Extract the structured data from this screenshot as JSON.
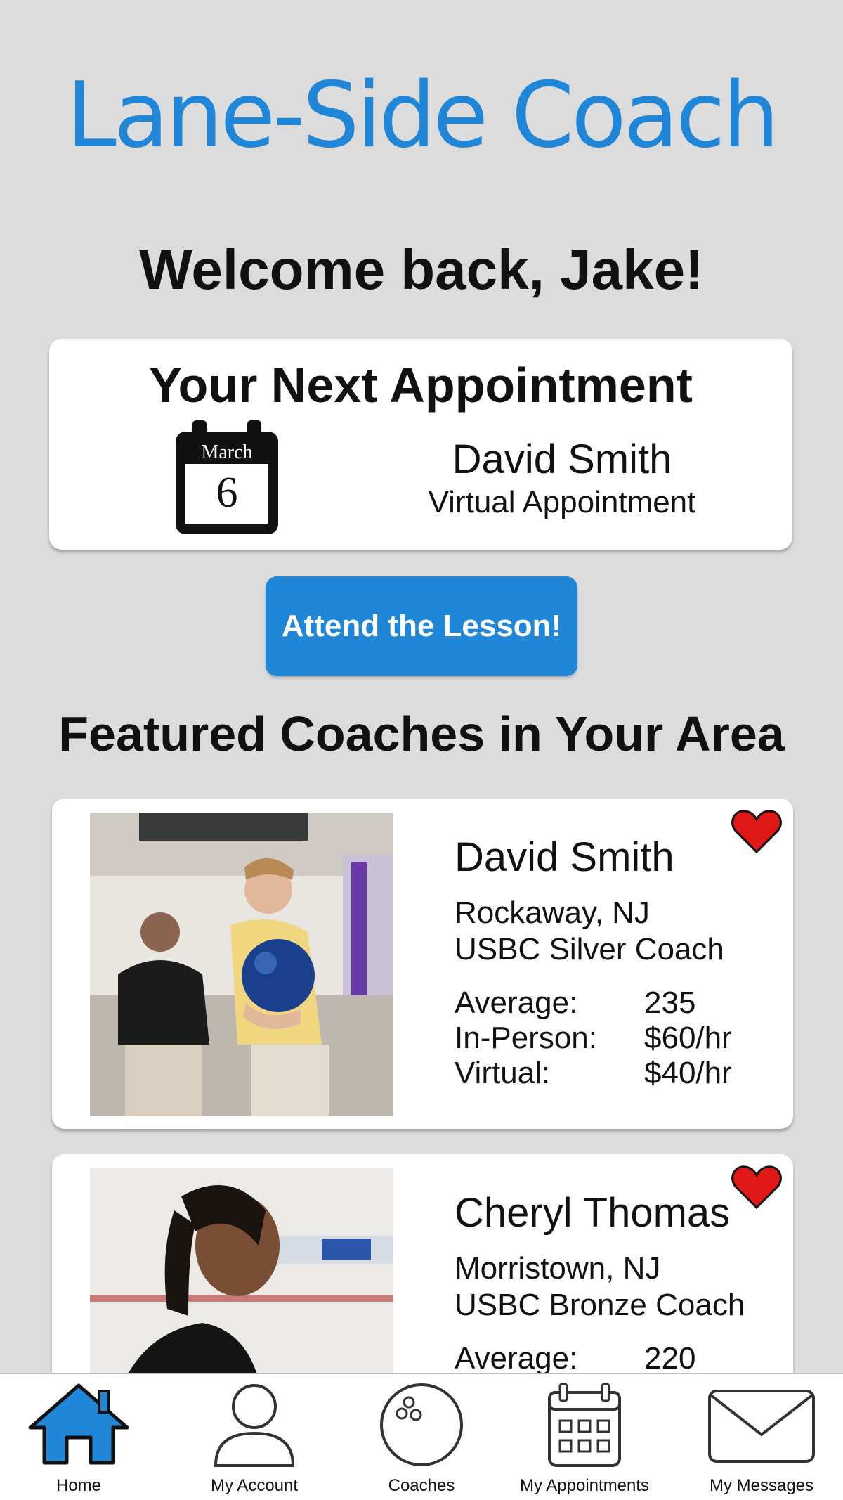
{
  "app": {
    "title": "Lane-Side Coach",
    "accent_color": "#1f86d8"
  },
  "welcome": "Welcome back, Jake!",
  "next_appointment": {
    "heading": "Your Next Appointment",
    "month": "March",
    "day": "6",
    "coach": "David Smith",
    "type": "Virtual Appointment",
    "icon": "calendar-icon"
  },
  "attend_button": "Attend the Lesson!",
  "featured_heading": "Featured Coaches in Your Area",
  "coaches": [
    {
      "name": "David Smith",
      "location": "Rockaway, NJ",
      "certification": "USBC Silver Coach",
      "favorite": true,
      "stats": [
        {
          "label": "Average:",
          "value": "235"
        },
        {
          "label": "In-Person:",
          "value": "$60/hr"
        },
        {
          "label": "Virtual:",
          "value": "$40/hr"
        }
      ]
    },
    {
      "name": "Cheryl Thomas",
      "location": "Morristown, NJ",
      "certification": "USBC Bronze Coach",
      "favorite": true,
      "stats": [
        {
          "label": "Average:",
          "value": "220"
        }
      ]
    }
  ],
  "tabs": [
    {
      "label": "Home",
      "icon": "home-icon",
      "active": true
    },
    {
      "label": "My Account",
      "icon": "person-icon",
      "active": false
    },
    {
      "label": "Coaches",
      "icon": "bowling-ball-icon",
      "active": false
    },
    {
      "label": "My Appointments",
      "icon": "calendar-icon",
      "active": false
    },
    {
      "label": "My Messages",
      "icon": "envelope-icon",
      "active": false
    }
  ]
}
